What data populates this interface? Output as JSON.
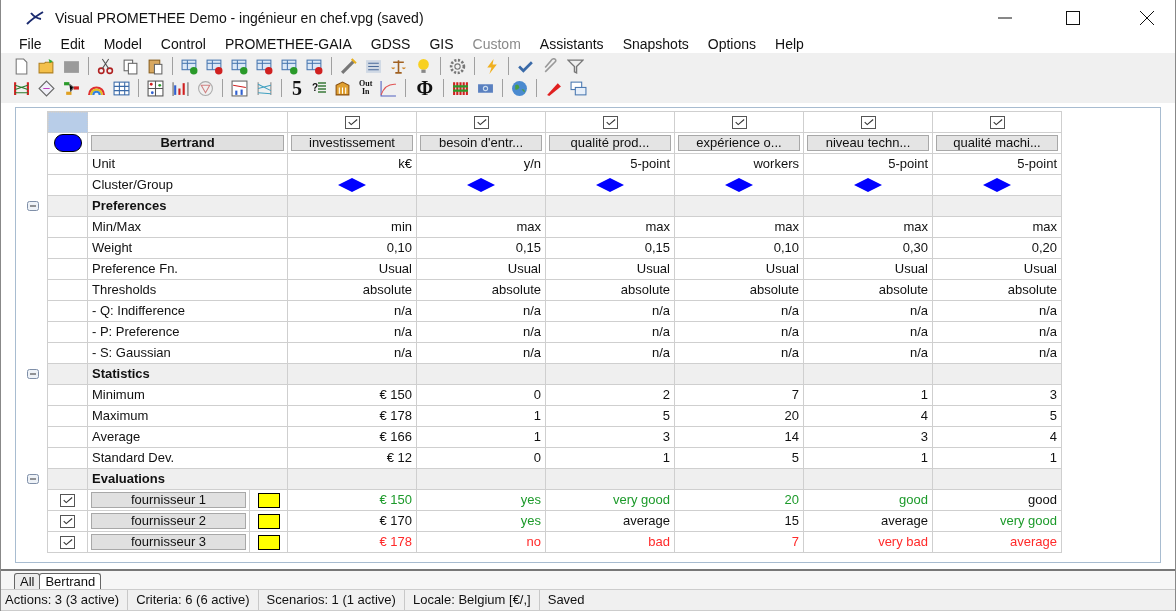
{
  "window": {
    "title": "Visual PROMETHEE Demo - ingénieur en chef.vpg (saved)"
  },
  "menu": [
    {
      "label": "File",
      "disabled": false
    },
    {
      "label": "Edit",
      "disabled": false
    },
    {
      "label": "Model",
      "disabled": false
    },
    {
      "label": "Control",
      "disabled": false
    },
    {
      "label": "PROMETHEE-GAIA",
      "disabled": false
    },
    {
      "label": "GDSS",
      "disabled": false
    },
    {
      "label": "GIS",
      "disabled": false
    },
    {
      "label": "Custom",
      "disabled": true
    },
    {
      "label": "Assistants",
      "disabled": false
    },
    {
      "label": "Snapshots",
      "disabled": false
    },
    {
      "label": "Options",
      "disabled": false
    },
    {
      "label": "Help",
      "disabled": false
    }
  ],
  "toolbar": {
    "glyphs": [
      "5",
      "?",
      "Out",
      "In",
      "Φ"
    ]
  },
  "table": {
    "scenario": "Bertrand",
    "unit_label": "Unit",
    "cluster_label": "Cluster/Group",
    "criteria": [
      {
        "name": "investissement",
        "checked": true,
        "unit": "k€"
      },
      {
        "name": "besoin d'entr...",
        "checked": true,
        "unit": "y/n"
      },
      {
        "name": "qualité prod...",
        "checked": true,
        "unit": "5-point"
      },
      {
        "name": "expérience o...",
        "checked": true,
        "unit": "workers"
      },
      {
        "name": "niveau techn...",
        "checked": true,
        "unit": "5-point"
      },
      {
        "name": "qualité machi...",
        "checked": true,
        "unit": "5-point"
      }
    ],
    "sections": [
      {
        "title": "Preferences",
        "expanded": true,
        "rows": [
          {
            "label": "Min/Max",
            "values": [
              "min",
              "max",
              "max",
              "max",
              "max",
              "max"
            ]
          },
          {
            "label": "Weight",
            "values": [
              "0,10",
              "0,15",
              "0,15",
              "0,10",
              "0,30",
              "0,20"
            ]
          },
          {
            "label": "Preference Fn.",
            "values": [
              "Usual",
              "Usual",
              "Usual",
              "Usual",
              "Usual",
              "Usual"
            ]
          },
          {
            "label": "Thresholds",
            "values": [
              "absolute",
              "absolute",
              "absolute",
              "absolute",
              "absolute",
              "absolute"
            ]
          },
          {
            "label": "- Q: Indifference",
            "values": [
              "n/a",
              "n/a",
              "n/a",
              "n/a",
              "n/a",
              "n/a"
            ]
          },
          {
            "label": "- P: Preference",
            "values": [
              "n/a",
              "n/a",
              "n/a",
              "n/a",
              "n/a",
              "n/a"
            ]
          },
          {
            "label": "- S: Gaussian",
            "values": [
              "n/a",
              "n/a",
              "n/a",
              "n/a",
              "n/a",
              "n/a"
            ]
          }
        ]
      },
      {
        "title": "Statistics",
        "expanded": true,
        "rows": [
          {
            "label": "Minimum",
            "values": [
              "€ 150",
              "0",
              "2",
              "7",
              "1",
              "3"
            ]
          },
          {
            "label": "Maximum",
            "values": [
              "€ 178",
              "1",
              "5",
              "20",
              "4",
              "5"
            ]
          },
          {
            "label": "Average",
            "values": [
              "€ 166",
              "1",
              "3",
              "14",
              "3",
              "4"
            ]
          },
          {
            "label": "Standard Dev.",
            "values": [
              "€ 12",
              "0",
              "1",
              "5",
              "1",
              "1"
            ]
          }
        ]
      },
      {
        "title": "Evaluations",
        "expanded": true,
        "actions": [
          {
            "name": "fournisseur 1",
            "checked": true,
            "color": "#ffff00",
            "values": [
              {
                "text": "€ 150",
                "color": "#1c9a2a"
              },
              {
                "text": "yes",
                "color": "#1c9a2a"
              },
              {
                "text": "very good",
                "color": "#1c9a2a"
              },
              {
                "text": "20",
                "color": "#1c9a2a"
              },
              {
                "text": "good",
                "color": "#1c9a2a"
              },
              {
                "text": "good",
                "color": "#111111"
              }
            ]
          },
          {
            "name": "fournisseur 2",
            "checked": true,
            "color": "#ffff00",
            "values": [
              {
                "text": "€ 170",
                "color": "#111111"
              },
              {
                "text": "yes",
                "color": "#1c9a2a"
              },
              {
                "text": "average",
                "color": "#111111"
              },
              {
                "text": "15",
                "color": "#111111"
              },
              {
                "text": "average",
                "color": "#111111"
              },
              {
                "text": "very good",
                "color": "#1c9a2a"
              }
            ]
          },
          {
            "name": "fournisseur 3",
            "checked": true,
            "color": "#ffff00",
            "values": [
              {
                "text": "€ 178",
                "color": "#ff2a2a"
              },
              {
                "text": "no",
                "color": "#ff2a2a"
              },
              {
                "text": "bad",
                "color": "#ff2a2a"
              },
              {
                "text": "7",
                "color": "#ff2a2a"
              },
              {
                "text": "very bad",
                "color": "#ff2a2a"
              },
              {
                "text": "average",
                "color": "#ff2a2a"
              }
            ]
          }
        ]
      }
    ]
  },
  "tabs": [
    {
      "label": "All",
      "selected": false
    },
    {
      "label": "Bertrand",
      "selected": true
    }
  ],
  "status_bar": [
    "Actions: 3 (3 active)",
    "Criteria: 6 (6 active)",
    "Scenarios: 1 (1 active)",
    "Locale: Belgium [€/,]",
    "Saved"
  ]
}
